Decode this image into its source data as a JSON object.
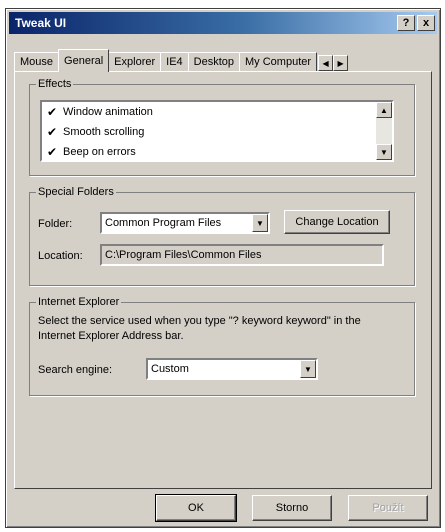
{
  "window": {
    "title": "Tweak UI",
    "help_glyph": "?",
    "close_glyph": "x"
  },
  "tabs": [
    {
      "label": "Mouse"
    },
    {
      "label": "General"
    },
    {
      "label": "Explorer"
    },
    {
      "label": "IE4"
    },
    {
      "label": "Desktop"
    },
    {
      "label": "My Computer"
    }
  ],
  "tab_scroll": {
    "left": "◀",
    "right": "▶"
  },
  "effects": {
    "title": "Effects",
    "items": [
      {
        "label": "Window animation",
        "check": "✔"
      },
      {
        "label": "Smooth scrolling",
        "check": "✔"
      },
      {
        "label": "Beep on errors",
        "check": "✔"
      }
    ],
    "scroll_up": "▲",
    "scroll_down": "▼"
  },
  "special_folders": {
    "title": "Special Folders",
    "folder_label": "Folder:",
    "folder_value": "Common Program Files",
    "dropdown_glyph": "▼",
    "change_button": "Change Location",
    "location_label": "Location:",
    "location_value": "C:\\Program Files\\Common Files"
  },
  "internet_explorer": {
    "title": "Internet Explorer",
    "description": "Select the service used when you type \"? keyword keyword\" in the Internet Explorer Address bar.",
    "search_label": "Search engine:",
    "search_value": "Custom",
    "dropdown_glyph": "▼"
  },
  "buttons": {
    "ok": "OK",
    "cancel": "Storno",
    "apply": "Použít"
  }
}
